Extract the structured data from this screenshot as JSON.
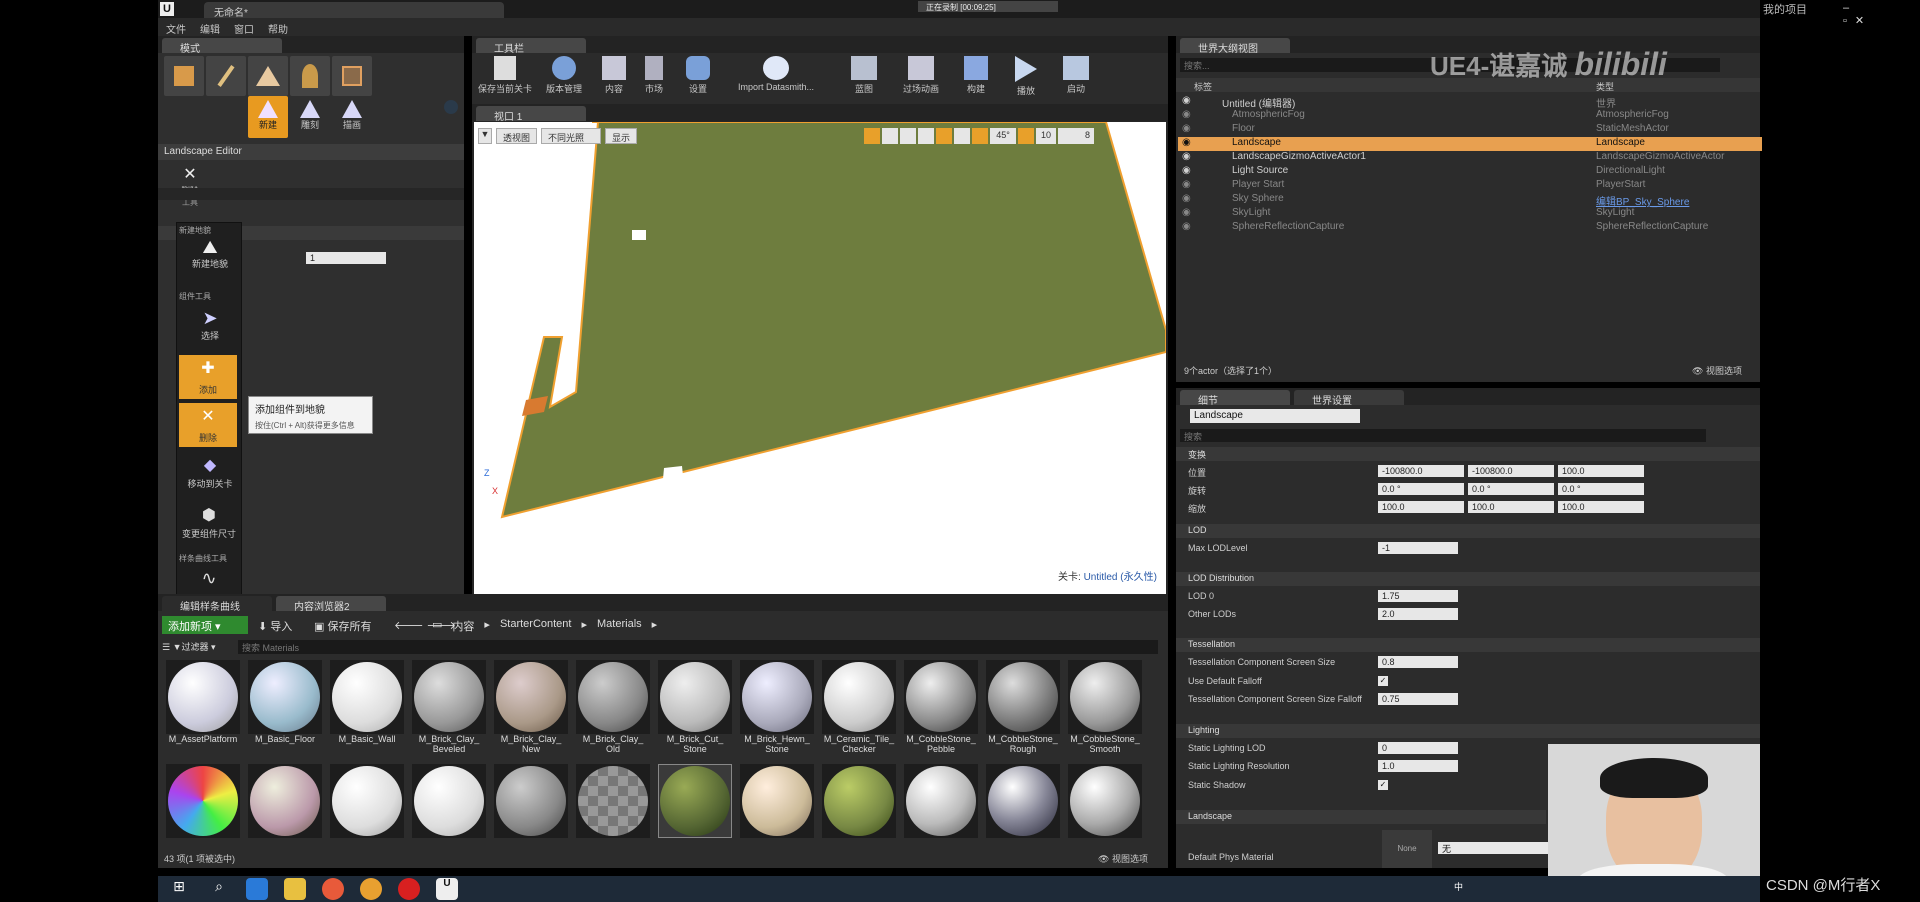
{
  "window": {
    "tab_title": "无命名*",
    "recording": "正在录制 [00:09:25]",
    "my_project": "我的项目"
  },
  "menu": [
    "文件",
    "编辑",
    "窗口",
    "帮助"
  ],
  "modes": {
    "tab": "模式",
    "tools": [
      "新建",
      "雕刻",
      "描画"
    ],
    "landscape_editor": "Landscape Editor",
    "delete_tool_label": "删除",
    "delete_tool_sub": "工具",
    "flyout": {
      "new_section": "新建地貌",
      "new_landscape": "新建地貌",
      "component_section": "组件工具",
      "select": "选择",
      "add": "添加",
      "delete": "删除",
      "move_to_level": "移动到关卡",
      "resize": "变更组件尺寸",
      "spline_section": "样条曲线工具",
      "edit_spline": "编辑样条曲线"
    },
    "field_value": "1",
    "tooltip_title": "添加组件到地貌",
    "tooltip_hint": "按住(Ctrl + Alt)获得更多信息"
  },
  "toolbar": {
    "tab": "工具栏",
    "buttons": [
      "保存当前关卡",
      "版本管理",
      "内容",
      "市场",
      "设置",
      "Import Datasmith...",
      "蓝图",
      "过场动画",
      "构建",
      "播放",
      "启动"
    ]
  },
  "viewport": {
    "tab": "视口 1",
    "perspective": "透视图",
    "lit": "不同光照",
    "show": "显示",
    "angle": "45°",
    "move_snap": "10",
    "cam_speed": "8",
    "level_label": "关卡:",
    "level_name": "Untitled (永久性)",
    "axis_z": "Z",
    "axis_x": "X"
  },
  "outliner": {
    "tab": "世界大纲视图",
    "search_placeholder": "搜索...",
    "col_label": "标签",
    "col_type": "类型",
    "rows": [
      {
        "label": "Untitled (编辑器)",
        "type": "世界"
      },
      {
        "label": "AtmosphericFog",
        "type": "AtmosphericFog"
      },
      {
        "label": "Floor",
        "type": "StaticMeshActor"
      },
      {
        "label": "Landscape",
        "type": "Landscape"
      },
      {
        "label": "LandscapeGizmoActiveActor1",
        "type": "LandscapeGizmoActiveActor"
      },
      {
        "label": "Light Source",
        "type": "DirectionalLight"
      },
      {
        "label": "Player Start",
        "type": "PlayerStart"
      },
      {
        "label": "Sky Sphere",
        "type": "编辑BP_Sky_Sphere"
      },
      {
        "label": "SkyLight",
        "type": "SkyLight"
      },
      {
        "label": "SphereReflectionCapture",
        "type": "SphereReflectionCapture"
      }
    ],
    "footer": "9个actor（选择了1个）",
    "view_options": "视图选项"
  },
  "watermark": "UE4-谌嘉诚",
  "details": {
    "tab": "细节",
    "tab2": "世界设置",
    "name": "Landscape",
    "search_placeholder": "搜索",
    "transform_section": "变换",
    "location_label": "位置",
    "location": [
      "-100800.0",
      "-100800.0",
      "100.0"
    ],
    "rotation_label": "旋转",
    "rotation": [
      "0.0 °",
      "0.0 °",
      "0.0 °"
    ],
    "scale_label": "缩放",
    "scale": [
      "100.0",
      "100.0",
      "100.0"
    ],
    "lod_section": "LOD",
    "max_lod_label": "Max LODLevel",
    "max_lod": "-1",
    "lod_dist_section": "LOD Distribution",
    "lod0_label": "LOD 0",
    "lod0": "1.75",
    "other_lods_label": "Other LODs",
    "other_lods": "2.0",
    "tess_section": "Tessellation",
    "tess_size_label": "Tessellation Component Screen Size",
    "tess_size": "0.8",
    "falloff_label": "Use Default Falloff",
    "tess_falloff_label": "Tessellation Component Screen Size Falloff",
    "tess_falloff": "0.75",
    "lighting_section": "Lighting",
    "static_lod_label": "Static Lighting LOD",
    "static_lod": "0",
    "static_res_label": "Static Lighting Resolution",
    "static_res": "1.0",
    "shadow_label": "Static Shadow",
    "landscape_section": "Landscape",
    "phys_label": "Default Phys Material",
    "phys_value": "无",
    "none_thumb": "None"
  },
  "content": {
    "tab1": "编辑样条曲线",
    "tab2": "内容浏览器2",
    "add_new": "添加新项",
    "import": "导入",
    "save_all": "保存所有",
    "path": [
      "内容",
      "StarterContent",
      "Materials"
    ],
    "filter": "过滤器",
    "search_placeholder": "搜索 Materials",
    "row1": [
      "M_AssetPlatform",
      "M_Basic_Floor",
      "M_Basic_Wall",
      "M_Brick_Clay_ Beveled",
      "M_Brick_Clay_ New",
      "M_Brick_Clay_ Old",
      "M_Brick_Cut_ Stone",
      "M_Brick_Hewn_ Stone",
      "M_Ceramic_Tile_ Checker",
      "M_CobbleStone_ Pebble",
      "M_CobbleStone_ Rough",
      "M_CobbleStone_ Smooth"
    ],
    "footer": "43 项(1 项被选中)",
    "view_options": "视图选项"
  },
  "taskbar": {
    "lang": "中"
  },
  "csdn": "CSDN @M行者X"
}
